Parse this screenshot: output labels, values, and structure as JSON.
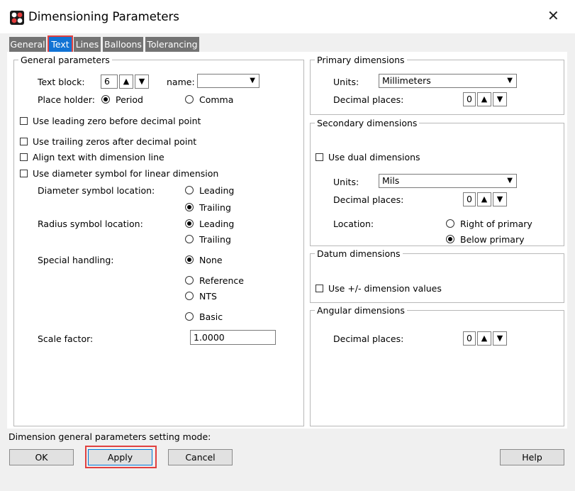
{
  "window": {
    "title": "Dimensioning Parameters",
    "close_glyph": "✕"
  },
  "tabs": [
    "General",
    "Text",
    "Lines",
    "Balloons",
    "Tolerancing"
  ],
  "general": {
    "legend": "General parameters",
    "text_block_label": "Text block:",
    "text_block_value": "6",
    "name_label": "name:",
    "name_value": "",
    "place_holder_label": "Place holder:",
    "period_label": "Period",
    "comma_label": "Comma",
    "leading_zero_label": "Use leading zero before decimal point",
    "trailing_zeros_label": "Use trailing zeros after decimal point",
    "align_text_label": "Align text with dimension line",
    "diameter_symbol_label": "Use diameter symbol for linear dimension",
    "diameter_loc_label": "Diameter symbol location:",
    "radius_loc_label": "Radius symbol location:",
    "leading_label": "Leading",
    "trailing_label": "Trailing",
    "special_label": "Special handling:",
    "none_label": "None",
    "reference_label": "Reference",
    "nts_label": "NTS",
    "basic_label": "Basic",
    "scale_label": "Scale factor:",
    "scale_value": "1.0000"
  },
  "primary": {
    "legend": "Primary dimensions",
    "units_label": "Units:",
    "units_value": "Millimeters",
    "decimal_label": "Decimal places:",
    "decimal_value": "0"
  },
  "secondary": {
    "legend": "Secondary dimensions",
    "dual_label": "Use dual dimensions",
    "units_label": "Units:",
    "units_value": "Mils",
    "decimal_label": "Decimal places:",
    "decimal_value": "0",
    "location_label": "Location:",
    "right_label": "Right of primary",
    "below_label": "Below primary"
  },
  "datum": {
    "legend": "Datum dimensions",
    "pm_label": "Use +/- dimension values"
  },
  "angular": {
    "legend": "Angular dimensions",
    "decimal_label": "Decimal places:",
    "decimal_value": "0"
  },
  "status_text": "Dimension general parameters setting mode:",
  "buttons": {
    "ok": "OK",
    "apply": "Apply",
    "cancel": "Cancel",
    "help": "Help"
  },
  "spin_up_glyph": "▲",
  "spin_down_glyph": "▼",
  "dropdown_glyph": "▼",
  "colors": {
    "active_tab": "#1173d4",
    "highlight": "#e04040",
    "tab_bg": "#737373"
  }
}
